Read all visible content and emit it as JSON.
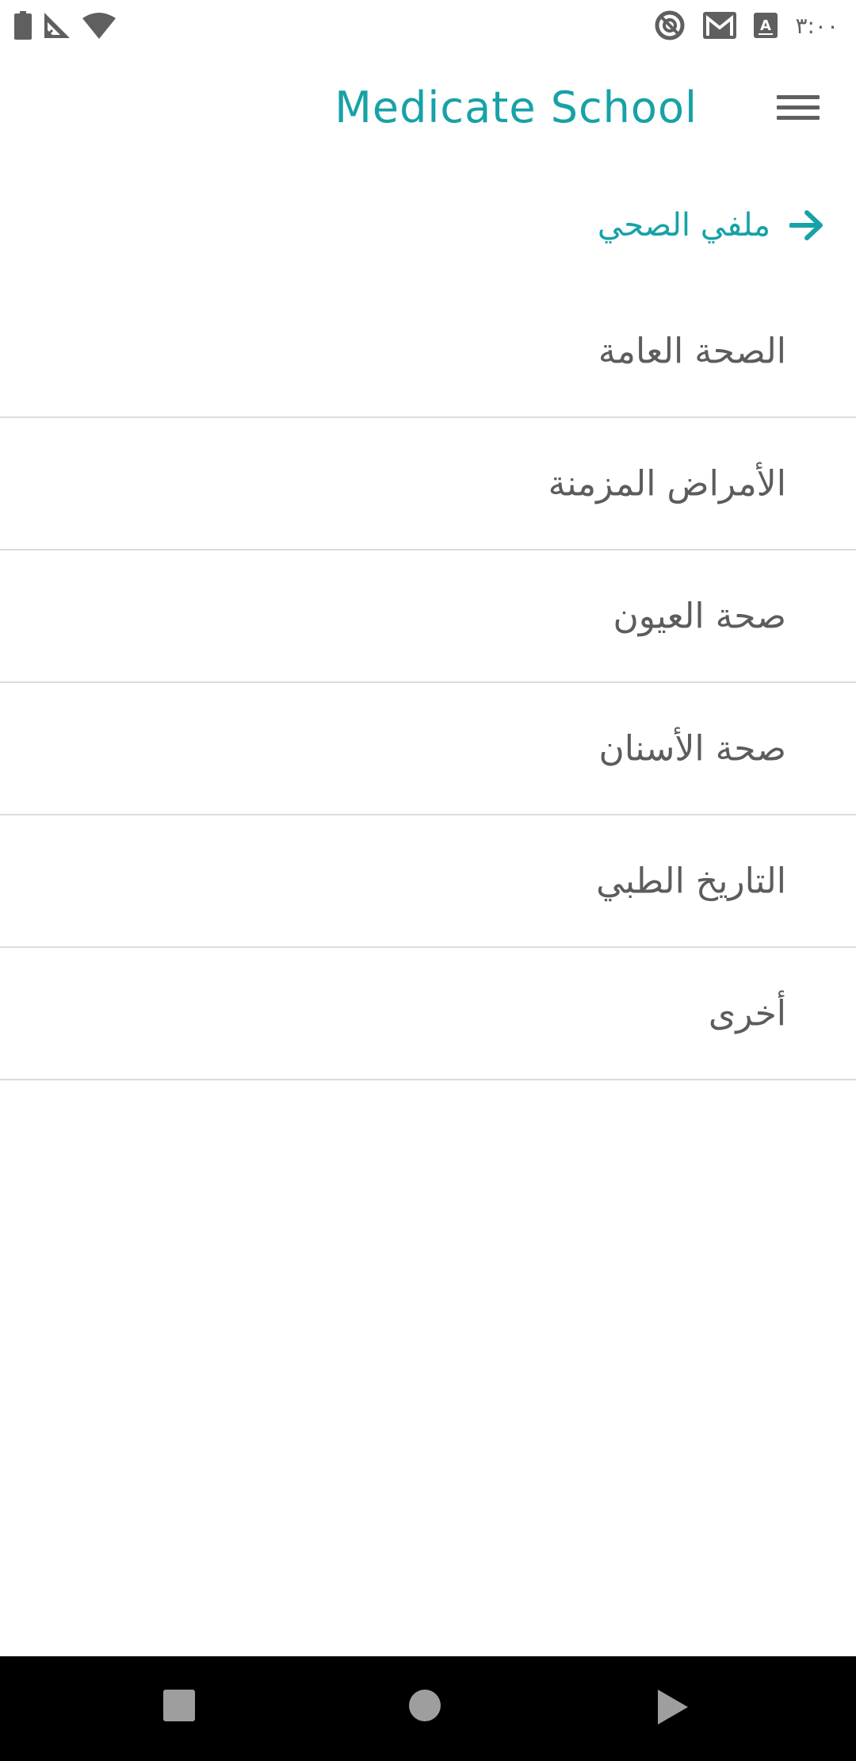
{
  "status_bar": {
    "time": "٣:٠٠",
    "icons_left": [
      "battery-icon",
      "signal-off-icon",
      "wifi-icon"
    ],
    "icons_right": [
      "do-not-disturb-icon",
      "gmail-icon",
      "keyboard-a-icon"
    ]
  },
  "app_bar": {
    "title": "Medicate School",
    "menu_icon": "hamburger-menu-icon"
  },
  "profile": {
    "label": "ملفي الصحي",
    "icon": "arrow-right-icon"
  },
  "menu": {
    "items": [
      {
        "label": "الصحة العامة"
      },
      {
        "label": "الأمراض المزمنة"
      },
      {
        "label": "صحة العيون"
      },
      {
        "label": "صحة الأسنان"
      },
      {
        "label": "التاريخ الطبي"
      },
      {
        "label": "أخرى"
      }
    ]
  },
  "nav_bar": {
    "buttons": [
      "recents-icon",
      "home-icon",
      "back-icon"
    ]
  },
  "colors": {
    "accent": "#17a2a6",
    "text": "#5c5c5c",
    "divider": "#dcdcdc",
    "nav_bar": "#000000",
    "nav_icon": "#9e9e9e"
  }
}
